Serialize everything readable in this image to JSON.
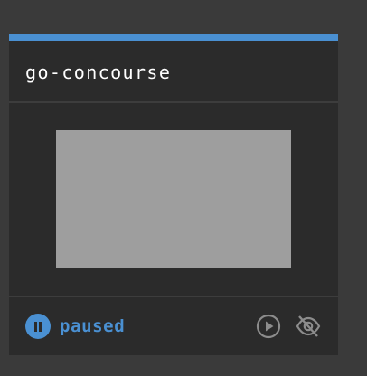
{
  "pipeline": {
    "name": "go-concourse",
    "status": "paused",
    "accent_color": "#4a90d2"
  },
  "icons": {
    "status": "pause-circle-icon",
    "play": "play-circle-icon",
    "hide": "eye-off-icon"
  }
}
